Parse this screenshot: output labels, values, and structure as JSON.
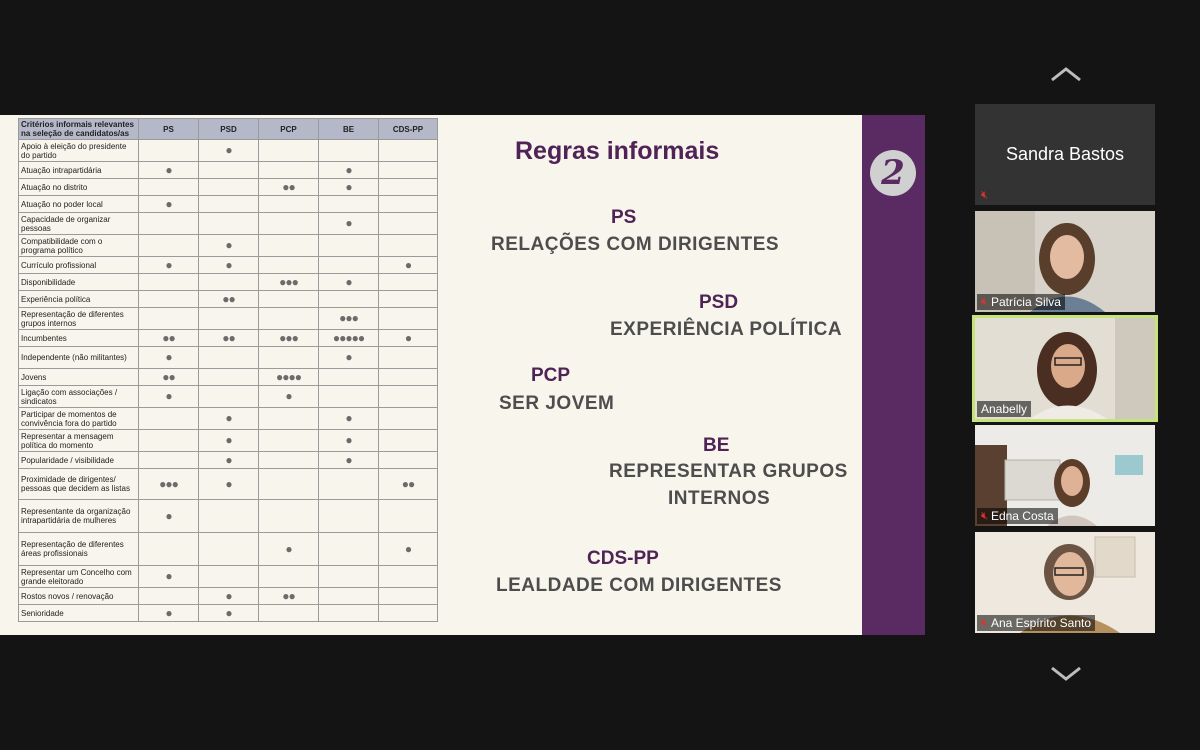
{
  "slide": {
    "number": "2",
    "title": "Regras informais",
    "rules": [
      {
        "party": "PS",
        "rule": "RELAÇÕES COM DIRIGENTES"
      },
      {
        "party": "PSD",
        "rule": "EXPERIÊNCIA POLÍTICA"
      },
      {
        "party": "PCP",
        "rule": "SER JOVEM"
      },
      {
        "party": "BE",
        "rule_line1": "REPRESENTAR GRUPOS",
        "rule_line2": "INTERNOS"
      },
      {
        "party": "CDS-PP",
        "rule": "LEALDADE COM DIRIGENTES"
      }
    ],
    "table": {
      "header": [
        "Critérios informais relevantes na seleção de candidatos/as",
        "PS",
        "PSD",
        "PCP",
        "BE",
        "CDS-PP"
      ],
      "rows": [
        {
          "label": "Apoio à eleição do presidente do partido",
          "cells": [
            "",
            "●",
            "",
            "",
            ""
          ]
        },
        {
          "label": "Atuação intrapartidária",
          "cells": [
            "●",
            "",
            "",
            "●",
            ""
          ]
        },
        {
          "label": "Atuação no distrito",
          "cells": [
            "",
            "",
            "●●",
            "●",
            ""
          ]
        },
        {
          "label": "Atuação no poder local",
          "cells": [
            "●",
            "",
            "",
            "",
            ""
          ]
        },
        {
          "label": "Capacidade de organizar pessoas",
          "cells": [
            "",
            "",
            "",
            "●",
            ""
          ]
        },
        {
          "label": "Compatibilidade com o programa político",
          "cells": [
            "",
            "●",
            "",
            "",
            ""
          ]
        },
        {
          "label": "Currículo profissional",
          "cells": [
            "●",
            "●",
            "",
            "",
            "●"
          ]
        },
        {
          "label": "Disponibilidade",
          "cells": [
            "",
            "",
            "●●●",
            "●",
            ""
          ]
        },
        {
          "label": "Experiência política",
          "cells": [
            "",
            "●●",
            "",
            "",
            ""
          ]
        },
        {
          "label": "Representação de diferentes grupos internos",
          "cells": [
            "",
            "",
            "",
            "●●●",
            ""
          ]
        },
        {
          "label": "Incumbentes",
          "cells": [
            "●●",
            "●●",
            "●●●",
            "●●●●●",
            "●"
          ]
        },
        {
          "label": "Independente (não militantes)",
          "cells": [
            "●",
            "",
            "",
            "●",
            ""
          ]
        },
        {
          "label": "Jovens",
          "cells": [
            "●●",
            "",
            "●●●●",
            "",
            ""
          ]
        },
        {
          "label": "Ligação com associações / sindicatos",
          "cells": [
            "●",
            "",
            "●",
            "",
            ""
          ]
        },
        {
          "label": "Participar de momentos de convivência fora do partido",
          "cells": [
            "",
            "●",
            "",
            "●",
            ""
          ]
        },
        {
          "label": "Representar a mensagem política do momento",
          "cells": [
            "",
            "●",
            "",
            "●",
            ""
          ]
        },
        {
          "label": "Popularidade / visibilidade",
          "cells": [
            "",
            "●",
            "",
            "●",
            ""
          ]
        },
        {
          "label": "Proximidade de dirigentes/ pessoas que decidem as listas",
          "cells": [
            "●●●",
            "●",
            "",
            "",
            "●●"
          ]
        },
        {
          "label": "Representante da organização intrapartidária de mulheres",
          "cells": [
            "●",
            "",
            "",
            "",
            ""
          ]
        },
        {
          "label": "Representação de diferentes áreas profissionais",
          "cells": [
            "",
            "",
            "●",
            "",
            "●"
          ]
        },
        {
          "label": "Representar um Concelho com grande eleitorado",
          "cells": [
            "●",
            "",
            "",
            "",
            ""
          ]
        },
        {
          "label": "Rostos novos / renovação",
          "cells": [
            "",
            "●",
            "●●",
            "",
            ""
          ]
        },
        {
          "label": "Senioridade",
          "cells": [
            "●",
            "●",
            "",
            "",
            ""
          ]
        }
      ]
    }
  },
  "participants": [
    {
      "name": "Sandra Bastos",
      "video": false,
      "muted": true
    },
    {
      "name": "Patrícia Silva",
      "video": true,
      "muted": true
    },
    {
      "name": "Anabelly",
      "video": true,
      "muted": false,
      "active": true
    },
    {
      "name": "Edna Costa",
      "video": true,
      "muted": true
    },
    {
      "name": "Ana Espírito Santo",
      "video": true,
      "muted": true
    }
  ],
  "icons": {
    "scroll_up": "chevron-up-icon",
    "scroll_down": "chevron-down-icon",
    "mute": "mic-muted-icon"
  },
  "colors": {
    "accent": "#5a2a62",
    "active_border": "#c6e37b",
    "mute": "#e0322f"
  }
}
